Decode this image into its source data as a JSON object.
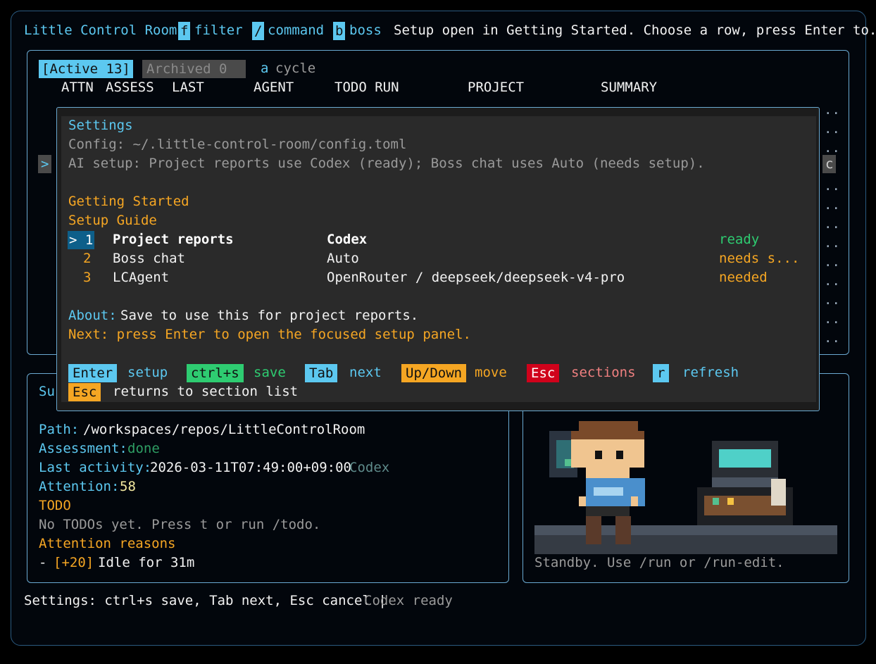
{
  "topbar": {
    "app_title": "Little Control Room",
    "filter_key": "f",
    "filter_label": "filter",
    "command_key": "/",
    "command_label": "command",
    "boss_key": "b",
    "boss_label": "boss",
    "status": "Setup open in Getting Started. Choose a row, press Enter to..."
  },
  "tabs": {
    "active": "[Active 13]",
    "archived": "Archived 0",
    "cycle_key": "a",
    "cycle_label": "cycle"
  },
  "columns": [
    "ATTN",
    "ASSESS",
    "LAST",
    "AGENT",
    "TODO RUN",
    "PROJECT",
    "SUMMARY"
  ],
  "row_cursor": ">",
  "right_edge_cell": "c",
  "settings": {
    "title": "Settings",
    "config": "Config: ~/.little-control-room/config.toml",
    "ai_setup": "AI setup: Project reports use Codex (ready); Boss chat uses Auto (needs setup).",
    "section": "Getting Started",
    "guide_title": "Setup Guide",
    "rows": [
      {
        "num": "> 1",
        "name": "Project reports",
        "provider": "Codex",
        "status": "ready"
      },
      {
        "num": "2",
        "name": "Boss chat",
        "provider": "Auto",
        "status": "needs s..."
      },
      {
        "num": "3",
        "name": "LCAgent",
        "provider": "OpenRouter / deepseek/deepseek-v4-pro",
        "status": "needed"
      }
    ],
    "about_label": "About:",
    "about_text": "Save to use this for project reports.",
    "next_text": "Next: press Enter to open the focused setup panel.",
    "hints": [
      {
        "key": "Enter",
        "label": "setup",
        "color": "#5cc8f0"
      },
      {
        "key": "ctrl+s",
        "label": "save",
        "color": "#2ecc71"
      },
      {
        "key": "Tab",
        "label": "next",
        "color": "#5cc8f0"
      },
      {
        "key": "Up/Down",
        "label": "move",
        "color": "#f5a623"
      },
      {
        "key": "Esc",
        "label": "sections",
        "color": "#d0021b"
      },
      {
        "key": "r",
        "label": "refresh",
        "color": "#5cc8f0"
      }
    ],
    "esc_key": "Esc",
    "esc_hint": "returns to section list"
  },
  "details": {
    "summary_fragment": "Su",
    "path_label": "Path:",
    "path_value": "/workspaces/repos/LittleControlRoom",
    "assessment_label": "Assessment:",
    "assessment_value": "done",
    "last_activity_label": "Last activity:",
    "last_activity_value": "2026-03-11T07:49:00+09:00",
    "last_activity_agent": "Codex",
    "attention_label": "Attention:",
    "attention_value": "58",
    "todo_heading": "TODO",
    "todo_text": "No TODOs yet. Press t or run /todo.",
    "reasons_heading": "Attention reasons",
    "reason_dash": "-",
    "reason_score": "[+20]",
    "reason_text": "Idle for 31m"
  },
  "agent_panel": {
    "status": "Standby. Use /run or /run-edit."
  },
  "footer": {
    "hint": "Settings: ctrl+s save, Tab next, Esc cancel |",
    "status": "Codex ready"
  }
}
